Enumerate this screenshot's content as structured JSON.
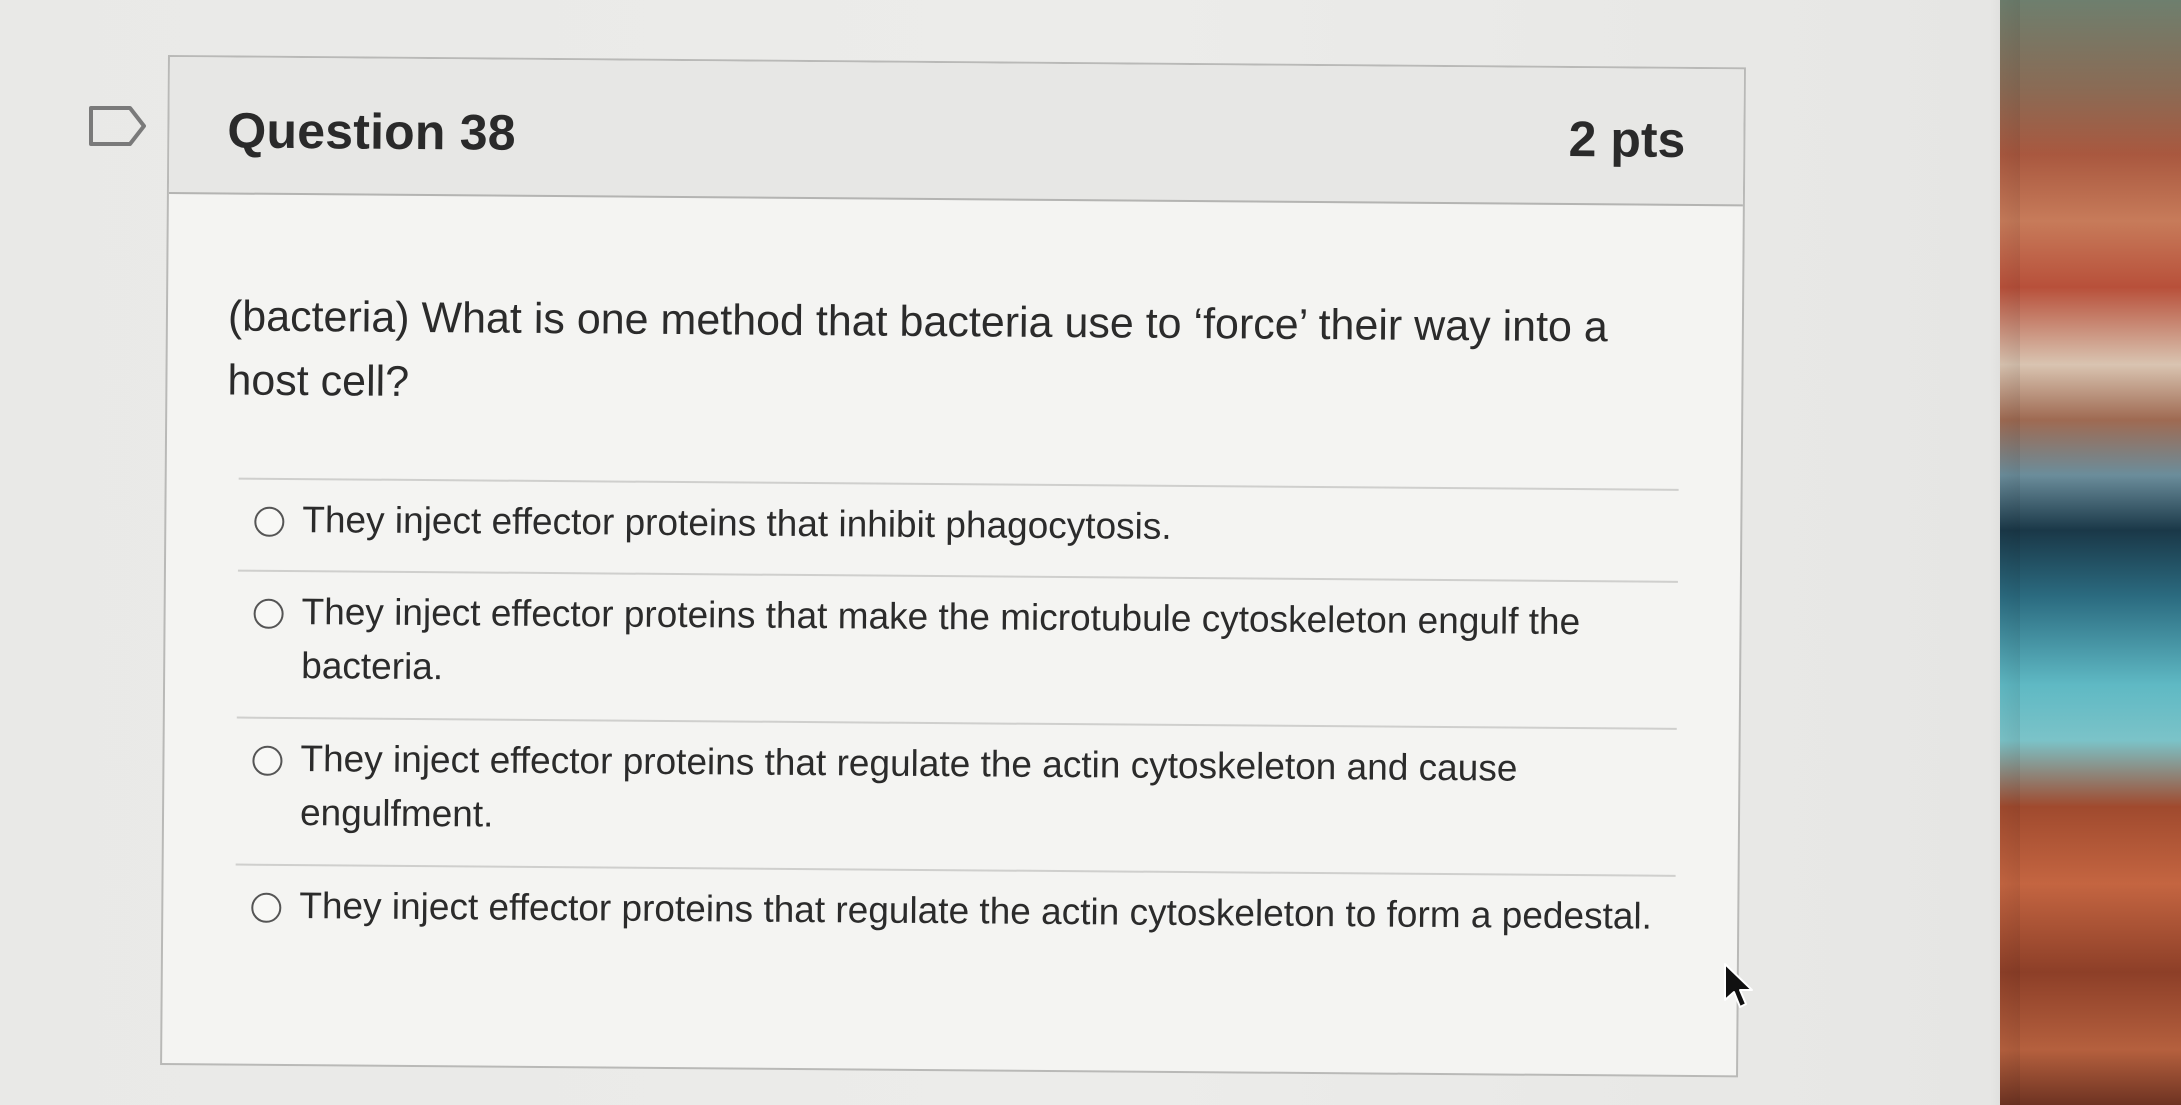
{
  "question": {
    "title": "Question 38",
    "points": "2 pts",
    "text": "(bacteria)  What is one method that bacteria use to ‘force’ their way into a host cell?",
    "answers": [
      {
        "label": "They inject effector proteins that inhibit phagocytosis."
      },
      {
        "label": "They inject effector proteins that make the microtubule cytoskeleton engulf the bacteria."
      },
      {
        "label": "They inject effector proteins that regulate the actin cytoskeleton and cause engulfment."
      },
      {
        "label": "They inject effector proteins that regulate the actin cytoskeleton to form a pedestal."
      }
    ]
  },
  "icons": {
    "flag": "bookmark-flag-icon",
    "cursor": "mouse-pointer-icon"
  },
  "colors": {
    "card_background": "#f4f4f2",
    "header_background": "#e7e7e5",
    "text": "#2b2b2b"
  }
}
